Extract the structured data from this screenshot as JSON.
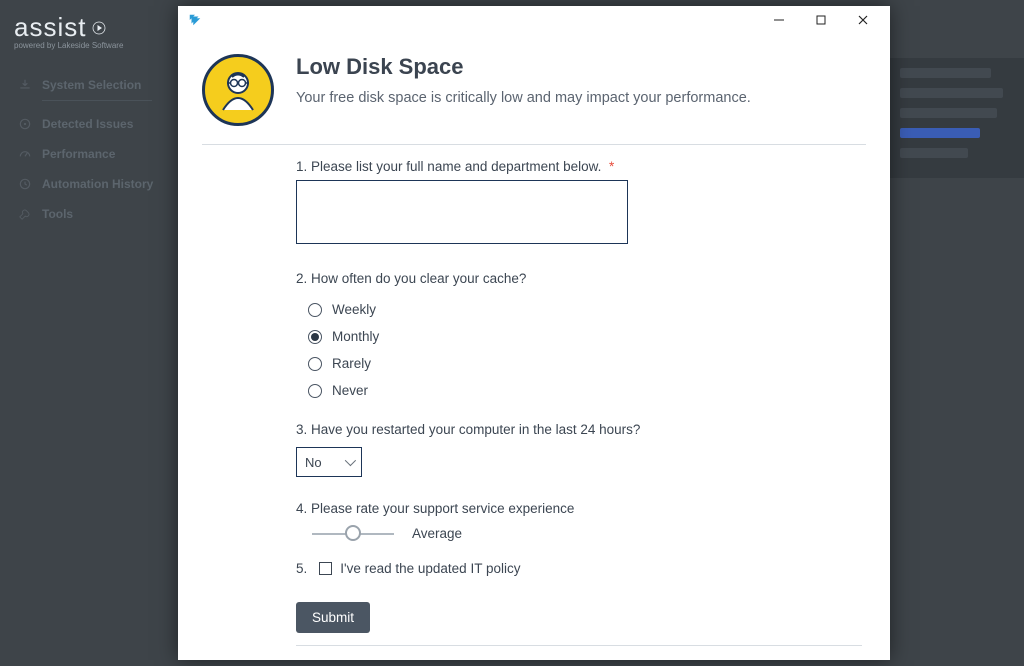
{
  "brand": {
    "name": "assist",
    "subtitle": "powered by Lakeside Software"
  },
  "sidebar": {
    "items": [
      {
        "label": "System Selection",
        "icon": "download"
      },
      {
        "label": "Detected Issues",
        "icon": "target"
      },
      {
        "label": "Performance",
        "icon": "gauge"
      },
      {
        "label": "Automation History",
        "icon": "history"
      },
      {
        "label": "Tools",
        "icon": "wrench"
      }
    ]
  },
  "dialog": {
    "title": "Low Disk Space",
    "description": "Your free disk space is critically low and may impact your performance.",
    "q1": {
      "label": "1. Please list your full name and department below.",
      "required_marker": "*"
    },
    "q2": {
      "label": "2. How often do you clear your cache?",
      "options": [
        "Weekly",
        "Monthly",
        "Rarely",
        "Never"
      ],
      "selected": "Monthly"
    },
    "q3": {
      "label": "3. Have you restarted your computer in the last 24 hours?",
      "value": "No"
    },
    "q4": {
      "label": "4. Please rate your support service experience",
      "value_label": "Average"
    },
    "q5": {
      "number": "5.",
      "label": "I've read the updated IT policy"
    },
    "submit_label": "Submit"
  }
}
